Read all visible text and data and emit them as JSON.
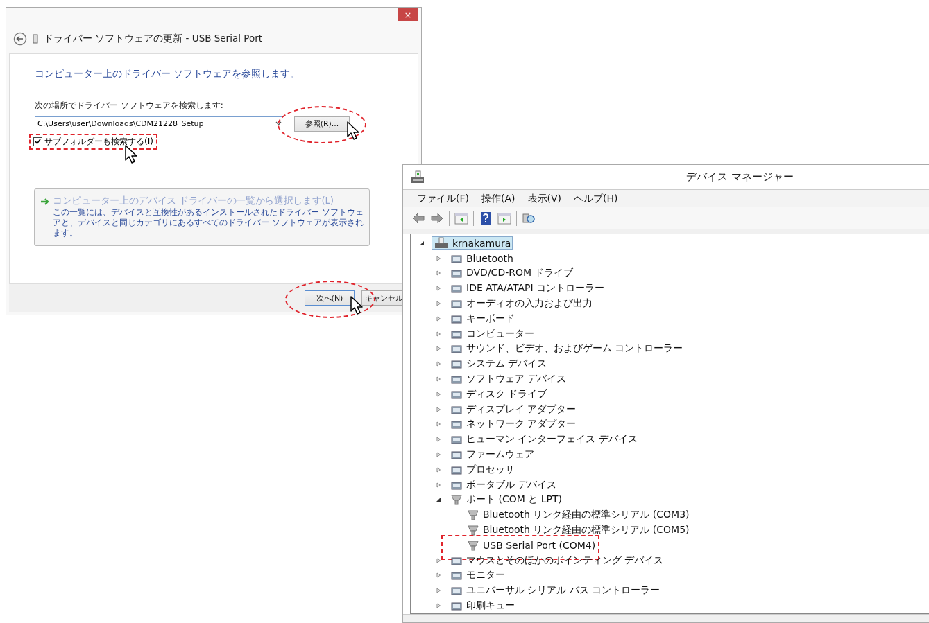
{
  "driver_dialog": {
    "close_label": "×",
    "title": "ドライバー ソフトウェアの更新 - USB Serial Port",
    "heading": "コンピューター上のドライバー ソフトウェアを参照します。",
    "search_label": "次の場所でドライバー ソフトウェアを検索します:",
    "path_value": "C:\\Users\\user\\Downloads\\CDM21228_Setup",
    "browse_button": "参照(R)...",
    "subfolder_checkbox": {
      "label": "サブフォルダーも検索する(I)",
      "checked": true
    },
    "pick_option": {
      "title": "コンピューター上のデバイス ドライバーの一覧から選択します(L)",
      "description": "この一覧には、デバイスと互換性があるインストールされたドライバー ソフトウェアと、デバイスと同じカテゴリにあるすべてのドライバー ソフトウェアが表示されます。"
    },
    "buttons": [
      "次へ(N)",
      "キャンセル"
    ]
  },
  "device_manager": {
    "title": "デバイス マネージャー",
    "menu": [
      "ファイル(F)",
      "操作(A)",
      "表示(V)",
      "ヘルプ(H)"
    ],
    "tree": [
      {
        "label": "krnakamura",
        "selected": true,
        "expanded": true,
        "children": [
          {
            "label": "Bluetooth",
            "expanded": false
          },
          {
            "label": "DVD/CD-ROM ドライブ",
            "expanded": false
          },
          {
            "label": "IDE ATA/ATAPI コントローラー",
            "expanded": false
          },
          {
            "label": "オーディオの入力および出力",
            "expanded": false
          },
          {
            "label": "キーボード",
            "expanded": false
          },
          {
            "label": "コンピューター",
            "expanded": false
          },
          {
            "label": "サウンド、ビデオ、およびゲーム コントローラー",
            "expanded": false
          },
          {
            "label": "システム デバイス",
            "expanded": false
          },
          {
            "label": "ソフトウェア デバイス",
            "expanded": false
          },
          {
            "label": "ディスク ドライブ",
            "expanded": false
          },
          {
            "label": "ディスプレイ アダプター",
            "expanded": false
          },
          {
            "label": "ネットワーク アダプター",
            "expanded": false
          },
          {
            "label": "ヒューマン インターフェイス デバイス",
            "expanded": false
          },
          {
            "label": "ファームウェア",
            "expanded": false
          },
          {
            "label": "プロセッサ",
            "expanded": false
          },
          {
            "label": "ポータブル デバイス",
            "expanded": false
          },
          {
            "label": "ポート (COM と LPT)",
            "expanded": true,
            "children": [
              {
                "label": "Bluetooth リンク経由の標準シリアル (COM3)"
              },
              {
                "label": "Bluetooth リンク経由の標準シリアル (COM5)"
              },
              {
                "label": "USB Serial Port (COM4)"
              }
            ]
          },
          {
            "label": "マウスとそのほかのポインティング デバイス",
            "expanded": false
          },
          {
            "label": "モニター",
            "expanded": false
          },
          {
            "label": "ユニバーサル シリアル バス コントローラー",
            "expanded": false
          },
          {
            "label": "印刷キュー",
            "expanded": false
          }
        ]
      }
    ]
  }
}
